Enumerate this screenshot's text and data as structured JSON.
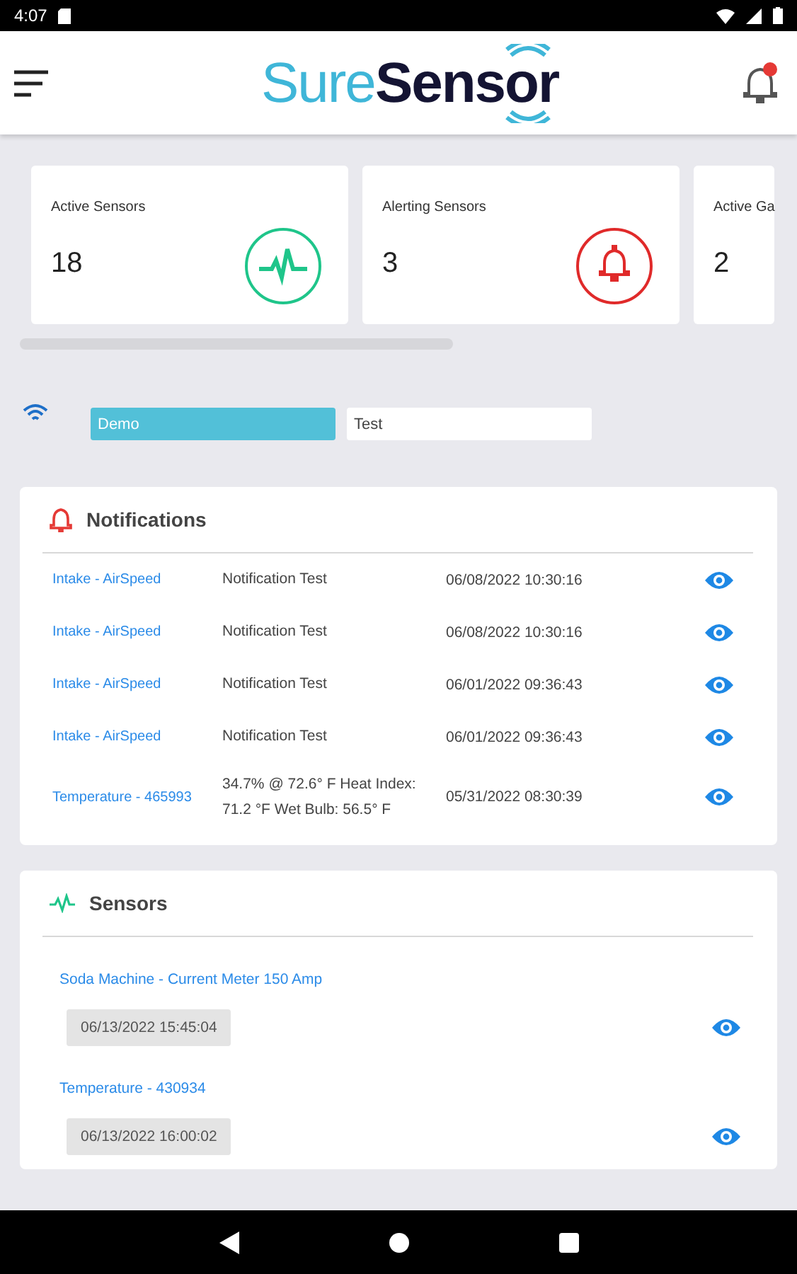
{
  "status_bar": {
    "time": "4:07"
  },
  "header": {
    "logo": {
      "part_1": "Sure",
      "part_2": "Sensor"
    },
    "notification_dot": true
  },
  "stats": [
    {
      "label": "Active Sensors",
      "value": "18",
      "kind": "pulse"
    },
    {
      "label": "Alerting Sensors",
      "value": "3",
      "kind": "alert"
    },
    {
      "label": "Active Ga",
      "value": "2",
      "kind": "none"
    }
  ],
  "tabs": [
    {
      "label": "Demo",
      "selected": true
    },
    {
      "label": "Test",
      "selected": false
    }
  ],
  "notifications": {
    "title": "Notifications",
    "rows": [
      {
        "sensor": "Intake - AirSpeed",
        "message": "Notification Test",
        "time": "06/08/2022 10:30:16"
      },
      {
        "sensor": "Intake - AirSpeed",
        "message": "Notification Test",
        "time": "06/08/2022 10:30:16"
      },
      {
        "sensor": "Intake - AirSpeed",
        "message": "Notification Test",
        "time": "06/01/2022 09:36:43"
      },
      {
        "sensor": "Intake - AirSpeed",
        "message": "Notification Test",
        "time": "06/01/2022 09:36:43"
      },
      {
        "sensor": "Temperature - 465993",
        "message": "34.7% @ 72.6° F Heat Index: 71.2 °F Wet Bulb: 56.5° F",
        "time": "05/31/2022 08:30:39"
      }
    ]
  },
  "sensors": {
    "title": "Sensors",
    "items": [
      {
        "name": "Soda Machine - Current Meter 150 Amp",
        "time": "06/13/2022 15:45:04"
      },
      {
        "name": "Temperature - 430934",
        "time": "06/13/2022 16:00:02"
      }
    ]
  }
}
